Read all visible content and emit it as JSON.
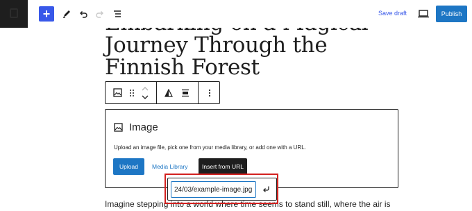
{
  "toolbar": {
    "save_draft_label": "Save draft",
    "publish_label": "Publish",
    "accent": "#1d76c4",
    "inserter_accent": "#3858e9",
    "icons": [
      "wordpress-logo-icon",
      "plus-icon",
      "pencil-icon",
      "undo-icon",
      "redo-icon",
      "list-view-icon",
      "preview-icon"
    ]
  },
  "post": {
    "title": "Embarking on a Magical Journey Through the Finnish Forest",
    "paragraph": "Imagine stepping into a world where time seems to stand still, where the air is"
  },
  "block_toolbar": {
    "icons": [
      "image-block-icon",
      "drag-handle-icon",
      "move-up-icon",
      "move-down-icon",
      "duotone-icon",
      "align-icon",
      "more-options-icon"
    ]
  },
  "image_block": {
    "title": "Image",
    "instructions": "Upload an image file, pick one from your media library, or add one with a URL.",
    "upload_label": "Upload",
    "media_library_label": "Media Library",
    "insert_url_label": "Insert from URL"
  },
  "url_popover": {
    "value": "24/03/example-image.jpg",
    "highlight_color": "#d3211f"
  }
}
